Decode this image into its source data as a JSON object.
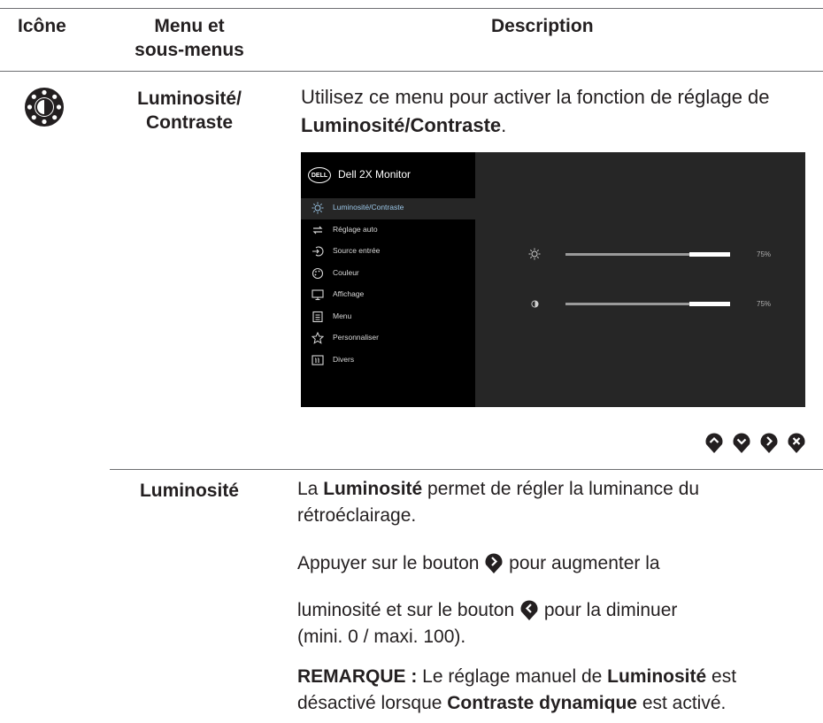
{
  "table_header": {
    "icon_col": "Icône",
    "menu_col_line1": "Menu et",
    "menu_col_line2": "sous-menus",
    "desc_col": "Description"
  },
  "row1": {
    "icon_name": "brightness-contrast-icon",
    "menu_line1": "Luminosité/",
    "menu_line2": "Contraste",
    "desc_part1": "Utilisez ce menu pour activer la fonction de réglage de ",
    "desc_bold": "Luminosité/Contraste",
    "desc_part2": "."
  },
  "osd": {
    "title": "Dell 2X Monitor",
    "logo_text": "DELL",
    "items": [
      {
        "label": "Luminosité/Contraste",
        "icon": "sun-icon",
        "active": true
      },
      {
        "label": "Réglage auto",
        "icon": "auto-adjust-icon",
        "active": false
      },
      {
        "label": "Source entrée",
        "icon": "input-source-icon",
        "active": false
      },
      {
        "label": "Couleur",
        "icon": "palette-icon",
        "active": false
      },
      {
        "label": "Affichage",
        "icon": "monitor-icon",
        "active": false
      },
      {
        "label": "Menu",
        "icon": "menu-icon",
        "active": false
      },
      {
        "label": "Personnaliser",
        "icon": "star-icon",
        "active": false
      },
      {
        "label": "Divers",
        "icon": "info-icon",
        "active": false
      }
    ],
    "brightness_value": "75%",
    "brightness_level": 0.75,
    "contrast_value": "75%",
    "contrast_level": 0.75
  },
  "nav_buttons": [
    "up-button-icon",
    "down-button-icon",
    "right-button-icon",
    "close-button-icon"
  ],
  "row2": {
    "menu": "Luminosité",
    "p1_pre": "La ",
    "p1_bold": "Luminosité",
    "p1_post": " permet de régler la luminance du",
    "p1_line2": "rétroéclairage.",
    "p2_pre": "Appuyer sur le bouton ",
    "p2_post": " pour augmenter la",
    "p3_pre": "luminosité et sur le bouton ",
    "p3_post": " pour la diminuer",
    "p3_line2": "(mini. 0 / maxi. 100).",
    "note_label": "REMARQUE :",
    "note_pre": " Le réglage manuel de ",
    "note_bold1": "Luminosité",
    "note_mid": " est",
    "note_line2_pre": "désactivé lorsque ",
    "note_bold2": "Contraste dynamique",
    "note_post": " est activé."
  },
  "colors": {
    "text": "#231f20",
    "osd_bg": "#000000",
    "osd_panel": "#262626",
    "active_label": "#9bc7e8"
  }
}
